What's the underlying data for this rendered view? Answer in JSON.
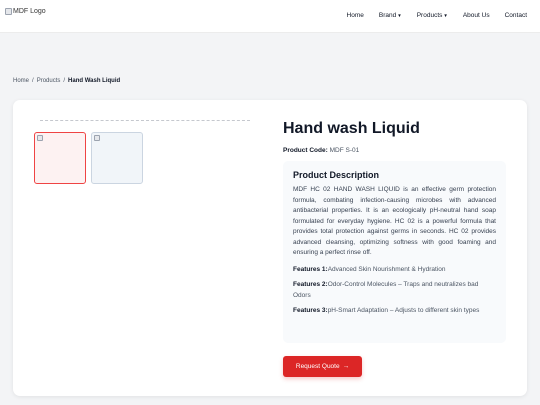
{
  "navbar": {
    "logo_alt": "MDF Logo",
    "links": [
      {
        "label": "Home"
      },
      {
        "label": "Brand",
        "dropdown": true
      },
      {
        "label": "Products",
        "dropdown": true
      },
      {
        "label": "About Us"
      },
      {
        "label": "Contact"
      }
    ]
  },
  "breadcrumb": {
    "items": [
      "Home",
      "Products",
      "Hand Wash Liquid"
    ],
    "separator": "/"
  },
  "product": {
    "title": "Hand wash Liquid",
    "code_label": "Product Code:",
    "code_value": "MDF S-01",
    "description_title": "Product Description",
    "description": "MDF HC 02 HAND WASH LIQUID is an effective germ protection formula, combating infection-causing microbes with advanced antibacterial properties. It is an ecologically pH-neutral hand soap formulated for everyday hygiene. HC 02 is a powerful formula that provides total protection against germs in seconds. HC 02 provides advanced cleansing, optimizing softness with good foaming and ensuring a perfect rinse off.",
    "features": [
      {
        "label": "Features 1:",
        "text": "Advanced Skin Nourishment & Hydration"
      },
      {
        "label": "Features 2:",
        "text": "Odor-Control Molecules – Traps and neutralizes bad Odors"
      },
      {
        "label": "Features 3:",
        "text": "pH-Smart Adaptation – Adjusts to different skin types"
      }
    ],
    "quote_button": "Request Quote",
    "quote_icon": "→"
  },
  "colors": {
    "accent": "#dc2626",
    "thumb_active_border": "#ef4444",
    "page_bg": "#f3f4f6"
  }
}
